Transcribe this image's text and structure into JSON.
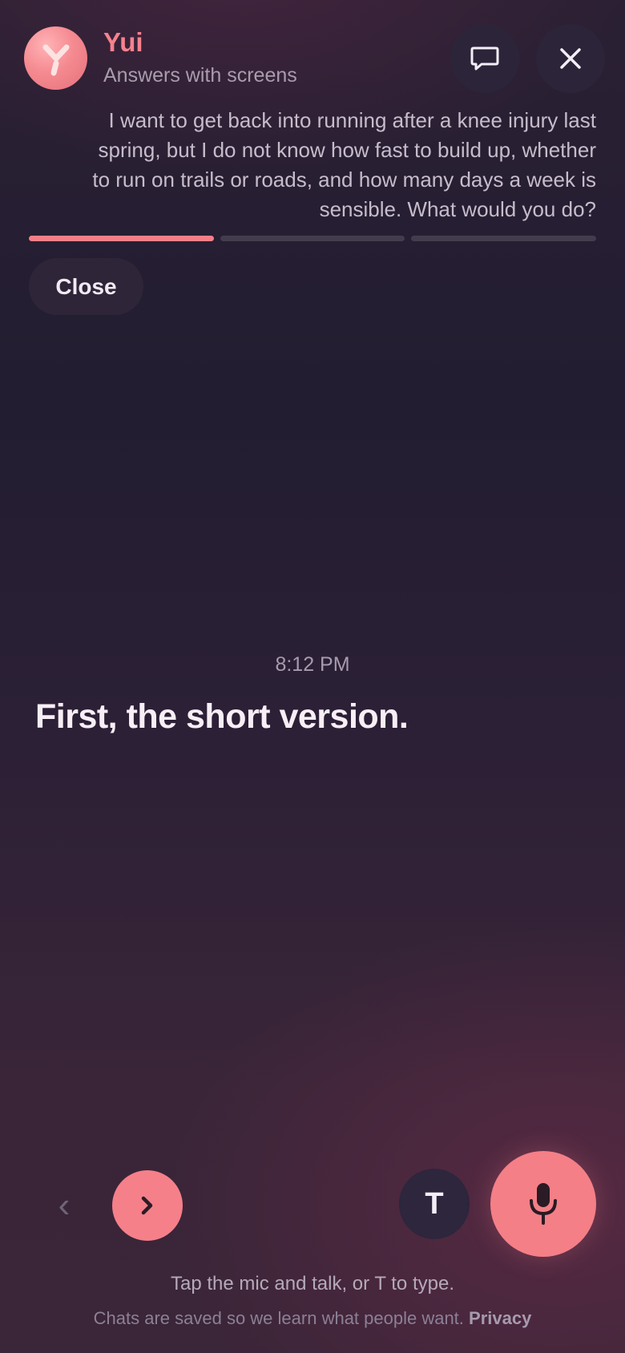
{
  "assistant": {
    "name": "Yui",
    "subtitle": "Answers with screens"
  },
  "header": {
    "chat_icon": "chat-bubble-icon",
    "close_icon": "close-icon"
  },
  "question": "I want to get back into running after a knee injury last spring, but I do not know how fast to build up, whether to run on trails or roads, and how many days a week is sensible. What would you do?",
  "progress": {
    "total_steps": 3,
    "current_step": 1
  },
  "close_button_label": "Close",
  "timestamp": "8:12 PM",
  "headline": "First, the short version.",
  "controls": {
    "prev_glyph": "‹",
    "type_label": "T",
    "mic_icon": "microphone-icon",
    "next_icon": "chevron-right-icon"
  },
  "hint": "Tap the mic and talk, or T to type.",
  "footer": {
    "text": "Chats are saved so we learn what people want.",
    "privacy_link": "Privacy"
  },
  "colors": {
    "accent": "#f47f87",
    "background": "#221d31"
  }
}
